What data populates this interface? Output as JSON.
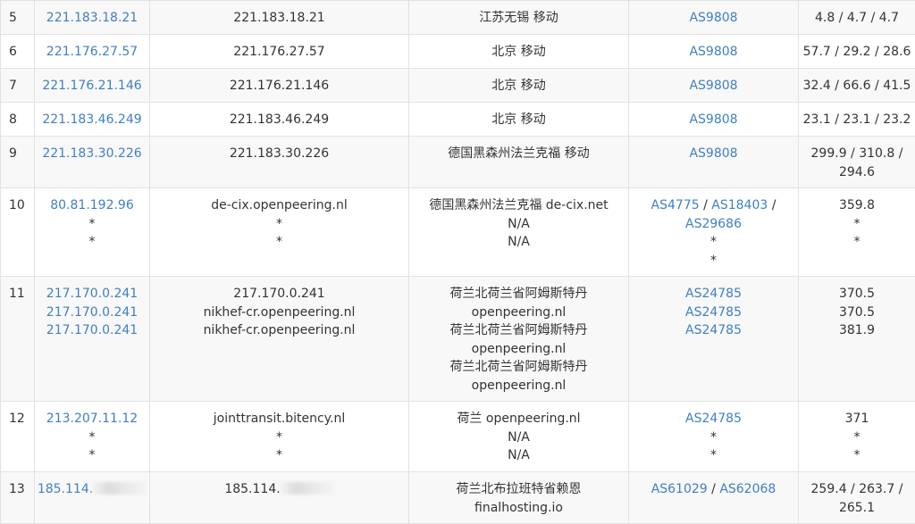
{
  "rows": [
    {
      "hop": "5",
      "ips": [
        "221.183.18.21"
      ],
      "hosts": [
        "221.183.18.21"
      ],
      "locs": [
        "江苏无锡 移动"
      ],
      "asns": [
        [
          "AS9808"
        ]
      ],
      "lat": [
        "4.8 / 4.7 / 4.7"
      ]
    },
    {
      "hop": "6",
      "ips": [
        "221.176.27.57"
      ],
      "hosts": [
        "221.176.27.57"
      ],
      "locs": [
        "北京 移动"
      ],
      "asns": [
        [
          "AS9808"
        ]
      ],
      "lat": [
        "57.7 / 29.2 / 28.6"
      ]
    },
    {
      "hop": "7",
      "ips": [
        "221.176.21.146"
      ],
      "hosts": [
        "221.176.21.146"
      ],
      "locs": [
        "北京 移动"
      ],
      "asns": [
        [
          "AS9808"
        ]
      ],
      "lat": [
        "32.4 / 66.6 / 41.5"
      ]
    },
    {
      "hop": "8",
      "ips": [
        "221.183.46.249"
      ],
      "hosts": [
        "221.183.46.249"
      ],
      "locs": [
        "北京 移动"
      ],
      "asns": [
        [
          "AS9808"
        ]
      ],
      "lat": [
        "23.1 / 23.1 / 23.2"
      ]
    },
    {
      "hop": "9",
      "ips": [
        "221.183.30.226"
      ],
      "hosts": [
        "221.183.30.226"
      ],
      "locs": [
        "德国黑森州法兰克福 移动"
      ],
      "asns": [
        [
          "AS9808"
        ]
      ],
      "lat": [
        "299.9 / 310.8 /",
        "294.6"
      ]
    },
    {
      "hop": "10",
      "ips": [
        "80.81.192.96",
        "*",
        "*"
      ],
      "hosts": [
        "de-cix.openpeering.nl",
        "*",
        "*"
      ],
      "locs": [
        "德国黑森州法兰克福 de-cix.net",
        "N/A",
        "N/A"
      ],
      "asns": [
        [
          "AS4775",
          "AS18403"
        ],
        [
          "AS29686"
        ],
        [
          "*"
        ],
        [
          "*"
        ]
      ],
      "lat": [
        "359.8",
        "*",
        "*"
      ]
    },
    {
      "hop": "11",
      "ips": [
        "217.170.0.241",
        "217.170.0.241",
        "217.170.0.241"
      ],
      "hosts": [
        "217.170.0.241",
        "nikhef-cr.openpeering.nl",
        "nikhef-cr.openpeering.nl"
      ],
      "locs": [
        "荷兰北荷兰省阿姆斯特丹",
        "openpeering.nl",
        "荷兰北荷兰省阿姆斯特丹",
        "openpeering.nl",
        "荷兰北荷兰省阿姆斯特丹",
        "openpeering.nl"
      ],
      "asns": [
        [
          "AS24785"
        ],
        [
          "AS24785"
        ],
        [
          "AS24785"
        ]
      ],
      "lat": [
        "370.5",
        "370.5",
        "381.9"
      ]
    },
    {
      "hop": "12",
      "ips": [
        "213.207.11.12",
        "*",
        "*"
      ],
      "hosts": [
        "jointtransit.bitency.nl",
        "*",
        "*"
      ],
      "locs": [
        "荷兰 openpeering.nl",
        "N/A",
        "N/A"
      ],
      "asns": [
        [
          "AS24785"
        ],
        [
          "*"
        ],
        [
          "*"
        ]
      ],
      "lat": [
        "371",
        "*",
        "*"
      ]
    },
    {
      "hop": "13",
      "ips": [
        "185.114."
      ],
      "hosts": [
        "185.114."
      ],
      "locs": [
        "荷兰北布拉班特省赖恩",
        "finalhosting.io"
      ],
      "asns": [
        [
          "AS61029",
          "AS62068"
        ]
      ],
      "lat": [
        "259.4 / 263.7 /",
        "265.1"
      ]
    }
  ],
  "colors": {
    "link": "#3f7fc4",
    "text": "#333333",
    "border": "#e2e2e2",
    "stripe": "#f8f8f8"
  }
}
